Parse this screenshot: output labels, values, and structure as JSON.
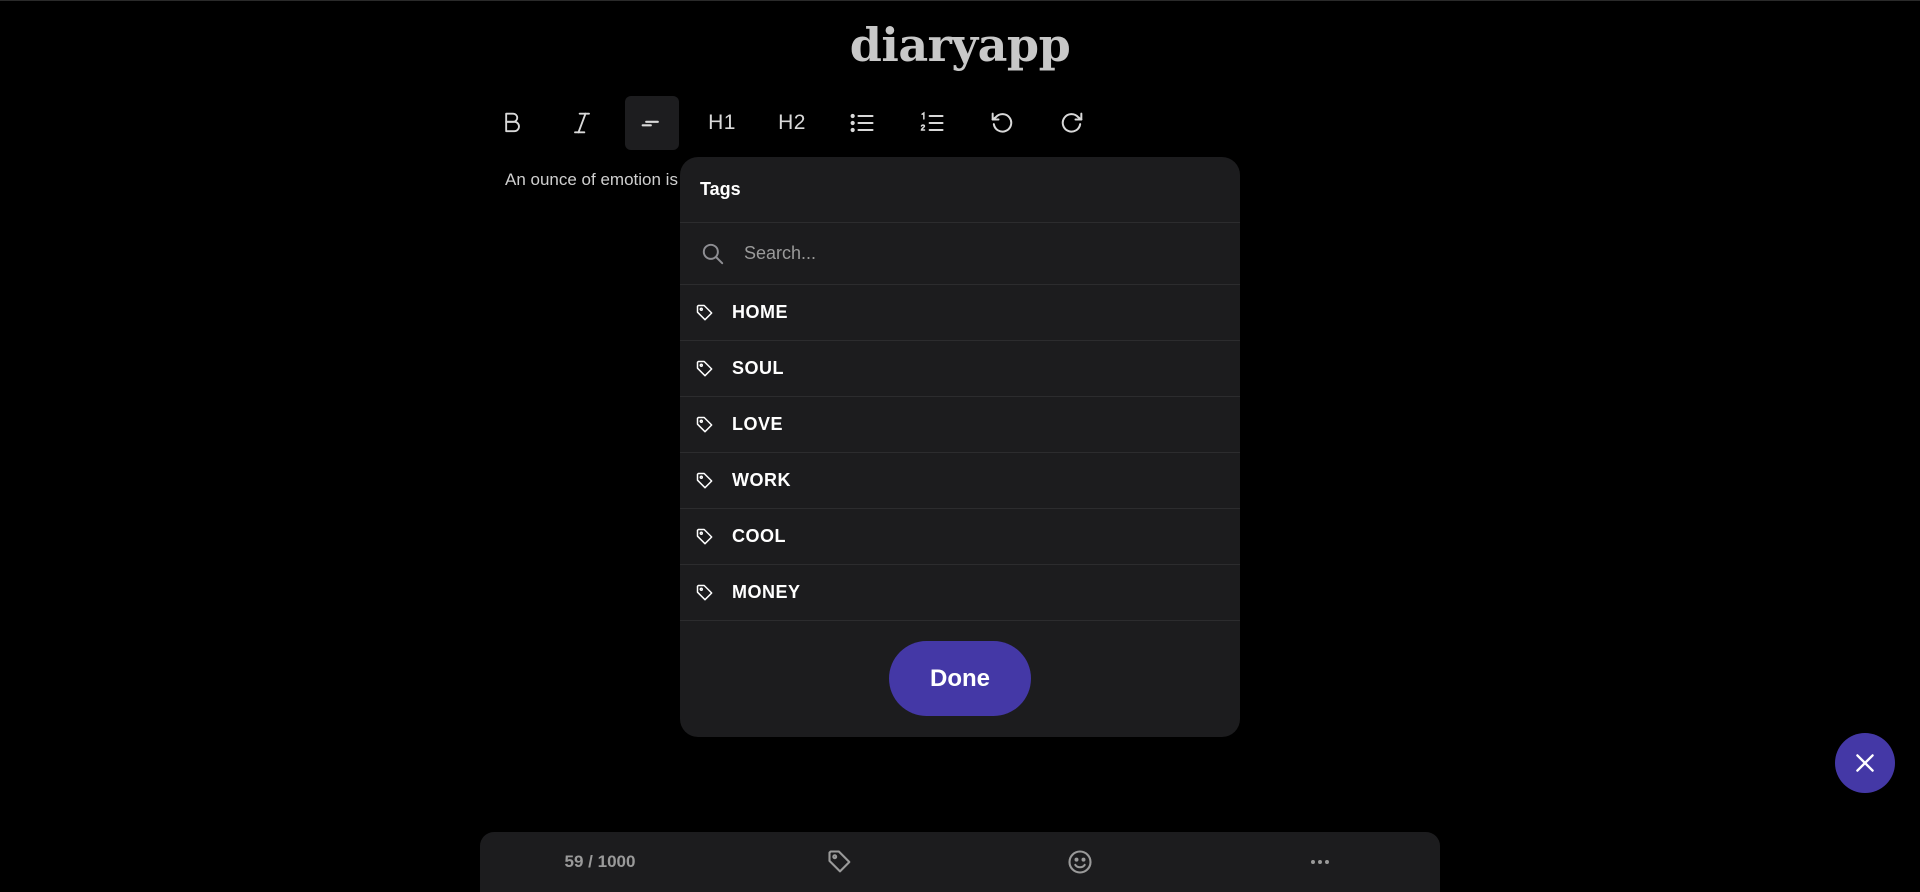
{
  "app": {
    "title": "diaryapp"
  },
  "toolbar": {
    "heading1_label": "H1",
    "heading2_label": "H2",
    "buttons": [
      "bold-icon",
      "italic-icon",
      "paragraph-icon",
      "heading-1",
      "heading-2",
      "bullet-list-icon",
      "numbered-list-icon",
      "undo-icon",
      "redo-icon"
    ],
    "active": "paragraph-icon"
  },
  "editor": {
    "visible_text": "An ounce of emotion is"
  },
  "tags_modal": {
    "title": "Tags",
    "search": {
      "placeholder": "Search...",
      "value": ""
    },
    "tags": [
      {
        "label": "HOME"
      },
      {
        "label": "SOUL"
      },
      {
        "label": "LOVE"
      },
      {
        "label": "WORK"
      },
      {
        "label": "COOL"
      },
      {
        "label": "MONEY"
      }
    ],
    "done_label": "Done"
  },
  "bottom_bar": {
    "word_count": "59 / 1000",
    "icons": [
      "tag-icon",
      "emoji-icon",
      "more-icon"
    ]
  },
  "colors": {
    "background": "#000000",
    "panel": "#1c1c1e",
    "accent": "#4438a6"
  }
}
